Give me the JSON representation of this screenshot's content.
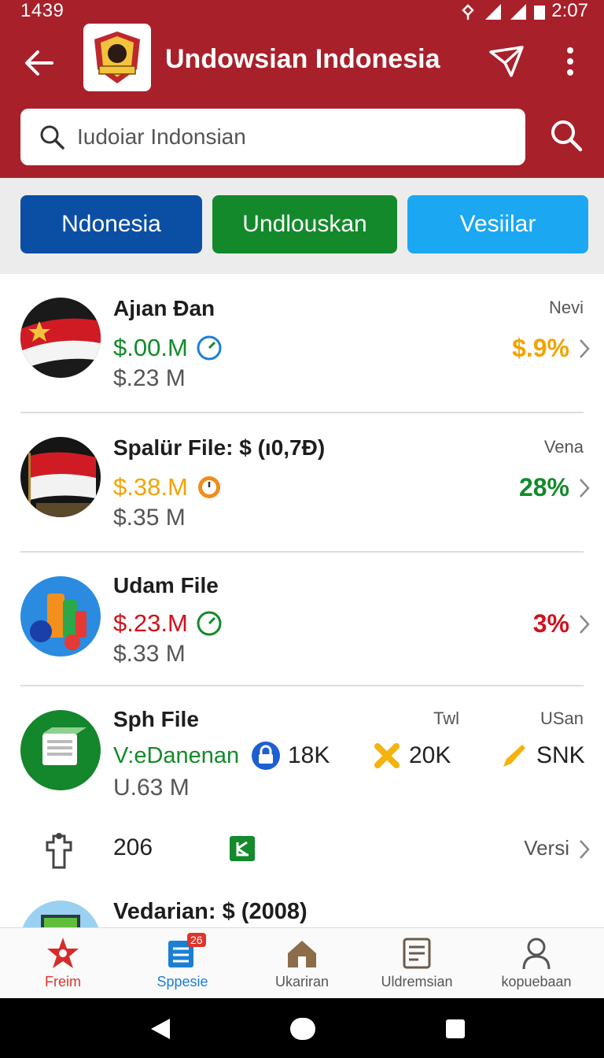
{
  "status_bar": {
    "left_text": "1439",
    "time": "2:07"
  },
  "header": {
    "title": "Undowsian Indonesia",
    "search_placeholder": "Iudoiar Indonsian"
  },
  "chips": [
    "Ndonesia",
    "Undlouskan",
    "Vesiilar"
  ],
  "rows": [
    {
      "title": "Ajıan Đan",
      "amount": "$.00.M",
      "amount_color": "#138a2b",
      "sub": "$.23 M",
      "tag": "Nevi",
      "pct": "$.9%",
      "pct_color": "#f2a300"
    },
    {
      "title": "Spalür File: $ (ı0,7Ð)",
      "amount": "$.38.M",
      "amount_color": "#f2a300",
      "sub": "$.35 M",
      "tag": "Vena",
      "pct": "28%",
      "pct_color": "#138a2b"
    },
    {
      "title": "Udam File",
      "amount": "$.23.M",
      "amount_color": "#d0121c",
      "sub": "$.33 M",
      "tag": "",
      "pct": "3%",
      "pct_color": "#d0121c"
    },
    {
      "title": "Sph File",
      "amount": "V:eDanenan",
      "amount_color": "#138a2b",
      "sub": "U.63 M",
      "tag": "USan",
      "tag2": "Twl",
      "stats": [
        "18K",
        "20K",
        "SNK"
      ]
    },
    {
      "title": "",
      "count": "206",
      "versi": "Versi"
    },
    {
      "title": "Vedarian: $ (2008)"
    }
  ],
  "bottom_nav": [
    {
      "label": "Freim",
      "color": "#e0352b",
      "icon": "star-icon"
    },
    {
      "label": "Sppesie",
      "color": "#1b7fd6",
      "icon": "list-icon",
      "badge": "26"
    },
    {
      "label": "Ukariran",
      "color": "#555555",
      "icon": "home-icon"
    },
    {
      "label": "Uldremsian",
      "color": "#555555",
      "icon": "document-icon"
    },
    {
      "label": "kopuebaan",
      "color": "#555555",
      "icon": "profile-icon"
    }
  ]
}
